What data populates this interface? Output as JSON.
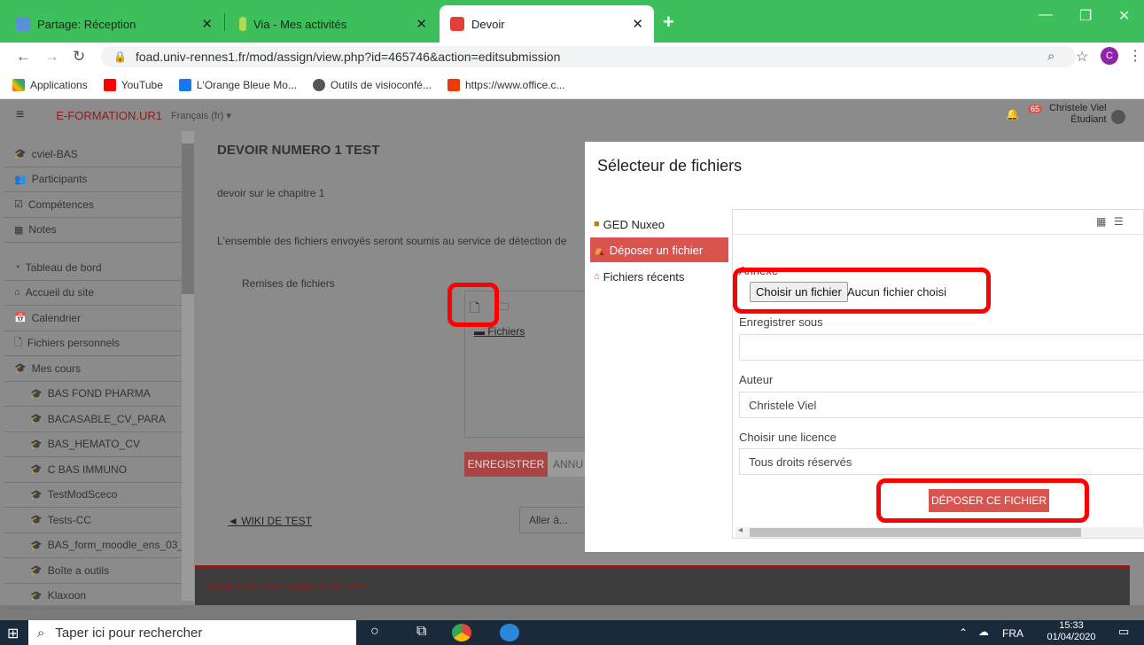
{
  "browser": {
    "tabs": [
      {
        "title": "Partage: Réception"
      },
      {
        "title": "Via - Mes activités"
      },
      {
        "title": "Devoir"
      }
    ],
    "url": "foad.univ-rennes1.fr/mod/assign/view.php?id=465746&action=editsubmission",
    "profile_initial": "C",
    "bookmarks": [
      {
        "label": "Applications"
      },
      {
        "label": "YouTube"
      },
      {
        "label": "L'Orange Bleue Mo..."
      },
      {
        "label": "Outils de visioconfé..."
      },
      {
        "label": "https://www.office.c..."
      }
    ]
  },
  "site": {
    "brand": "E-FORMATION.UR1",
    "language": "Français (fr) ▾",
    "notif_count": "65",
    "user_name": "Christele Viel",
    "user_role": "Étudiant"
  },
  "sidebar": {
    "items": [
      {
        "label": "cviel-BAS",
        "icon": "graduation-cap",
        "indent": false
      },
      {
        "label": "Participants",
        "icon": "users",
        "indent": false
      },
      {
        "label": "Compétences",
        "icon": "check-square",
        "indent": false
      },
      {
        "label": "Notes",
        "icon": "table",
        "indent": false
      },
      {
        "label": "",
        "icon": "",
        "indent": false
      },
      {
        "label": "Tableau de bord",
        "icon": "dashboard",
        "indent": false
      },
      {
        "label": "Accueil du site",
        "icon": "home",
        "indent": false
      },
      {
        "label": "Calendrier",
        "icon": "calendar",
        "indent": false
      },
      {
        "label": "Fichiers personnels",
        "icon": "file",
        "indent": false
      },
      {
        "label": "Mes cours",
        "icon": "graduation-cap",
        "indent": false
      },
      {
        "label": "BAS FOND PHARMA",
        "icon": "graduation-cap",
        "indent": true
      },
      {
        "label": "BACASABLE_CV_PARA",
        "icon": "graduation-cap",
        "indent": true
      },
      {
        "label": "BAS_HEMATO_CV",
        "icon": "graduation-cap",
        "indent": true
      },
      {
        "label": "C BAS IMMUNO",
        "icon": "graduation-cap",
        "indent": true
      },
      {
        "label": "TestModSceco",
        "icon": "graduation-cap",
        "indent": true
      },
      {
        "label": "Tests-CC",
        "icon": "graduation-cap",
        "indent": true
      },
      {
        "label": "BAS_form_moodle_ens_03_20",
        "icon": "graduation-cap",
        "indent": true
      },
      {
        "label": "Boîte a outils",
        "icon": "graduation-cap",
        "indent": true
      },
      {
        "label": "Klaxoon",
        "icon": "graduation-cap",
        "indent": true
      }
    ]
  },
  "page": {
    "title": "DEVOIR NUMERO 1 TEST",
    "description": "devoir sur le chapitre 1",
    "plagiarism_notice": "L'ensemble des fichiers envoyés seront soumis au service de détection de",
    "submissions_label": "Remises de fichiers",
    "folder_label": "Fichiers",
    "save_button": "ENREGISTRER",
    "cancel_button": "ANNU",
    "prev_link": "◄ WIKI DE TEST",
    "jump_select": "Aller à...",
    "footer_link": "Résumé de conservation de données"
  },
  "file_picker": {
    "title": "Sélecteur de fichiers",
    "repos": [
      {
        "label": "GED Nuxeo"
      },
      {
        "label": "Déposer un fichier"
      },
      {
        "label": "Fichiers récents"
      }
    ],
    "attachment_label": "Annexe",
    "choose_button": "Choisir un fichier",
    "no_file": "Aucun fichier choisi",
    "save_as_label": "Enregistrer sous",
    "save_as_value": "",
    "author_label": "Auteur",
    "author_value": "Christele Viel",
    "license_label": "Choisir une licence",
    "license_value": "Tous droits réservés",
    "upload_button": "DÉPOSER CE FICHIER"
  },
  "taskbar": {
    "search_placeholder": "Taper ici pour rechercher",
    "lang": "FRA",
    "time": "15:33",
    "date": "01/04/2020"
  }
}
